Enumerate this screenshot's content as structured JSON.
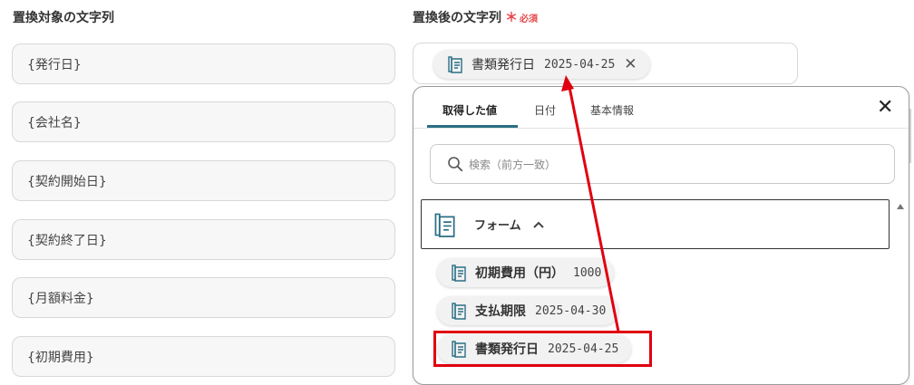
{
  "left": {
    "title": "置換対象の文字列",
    "fields": [
      "{発行日}",
      "{会社名}",
      "{契約開始日}",
      "{契約終了日}",
      "{月額料金}",
      "{初期費用}"
    ]
  },
  "right": {
    "title": "置換後の文字列",
    "required_mark": "＊",
    "required_text": "必須",
    "selected_chip": {
      "label": "書類発行日",
      "value": "2025-04-25",
      "close": "✕"
    }
  },
  "popup": {
    "tabs": [
      "取得した値",
      "日付",
      "基本情報"
    ],
    "active_tab": "取得した値",
    "close": "✕",
    "search_placeholder": "検索（前方一致）",
    "section_title": "フォーム",
    "items": [
      {
        "label": "初期費用（円）",
        "value": "1000"
      },
      {
        "label": "支払期限",
        "value": "2025-04-30"
      },
      {
        "label": "書類発行日",
        "value": "2025-04-25"
      }
    ]
  },
  "colors": {
    "accent": "#2a6f84",
    "required": "#e8474c",
    "annotation": "#e0000f"
  },
  "icons": {
    "form": "form-document-icon",
    "search": "search-icon",
    "chevron": "chevron-up-icon",
    "close": "close-icon"
  }
}
